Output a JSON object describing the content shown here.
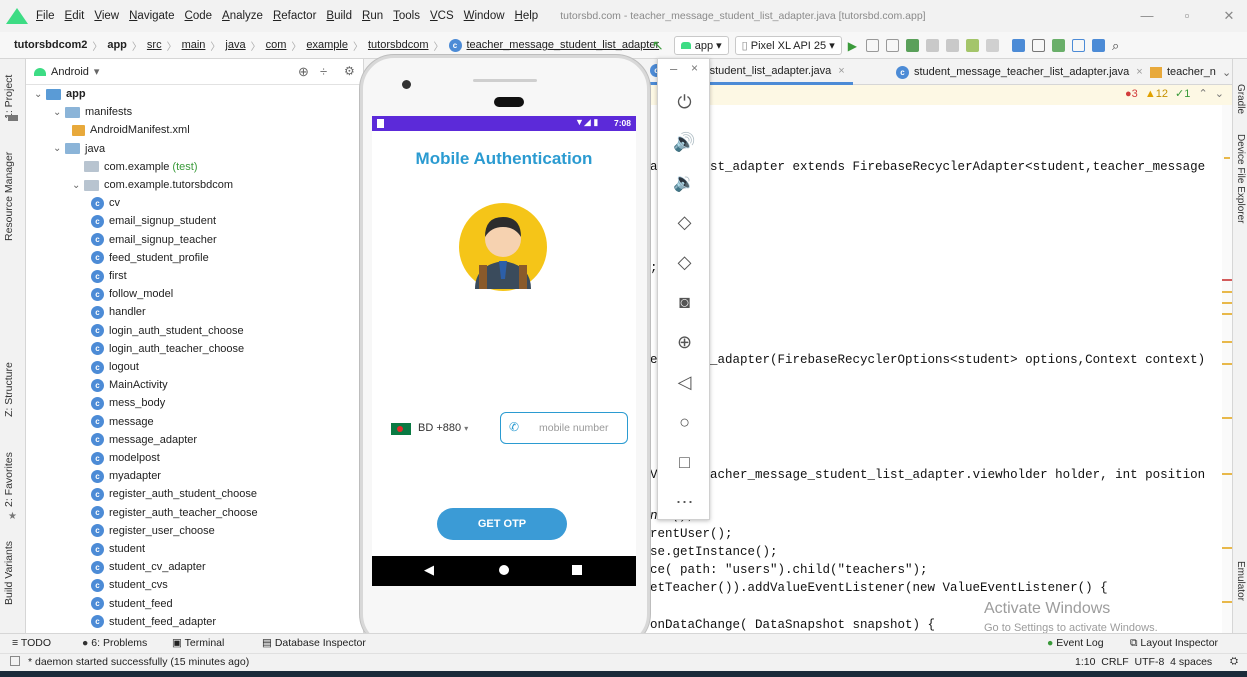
{
  "titlebar": {
    "menu": [
      "File",
      "Edit",
      "View",
      "Navigate",
      "Code",
      "Analyze",
      "Refactor",
      "Build",
      "Run",
      "Tools",
      "VCS",
      "Window",
      "Help"
    ],
    "window_title": "tutorsbd.com - teacher_message_student_list_adapter.java [tutorsbd.com.app]"
  },
  "breadcrumb": [
    "tutorsbdcom2",
    "app",
    "src",
    "main",
    "java",
    "com",
    "example",
    "tutorsbdcom",
    "teacher_message_student_list_adapter"
  ],
  "toolbar": {
    "run_config": "app",
    "device": "Pixel XL API 25"
  },
  "left_tabs": [
    "1: Project",
    "Resource Manager",
    "Z: Structure",
    "2: Favorites",
    "Build Variants"
  ],
  "right_tabs": [
    "Gradle",
    "Device File Explorer",
    "Emulator"
  ],
  "project": {
    "view_mode": "Android",
    "tree": [
      {
        "label": "app",
        "level": 0,
        "kind": "module"
      },
      {
        "label": "manifests",
        "level": 1,
        "kind": "folder"
      },
      {
        "label": "AndroidManifest.xml",
        "level": 2,
        "kind": "xml"
      },
      {
        "label": "java",
        "level": 1,
        "kind": "folder"
      },
      {
        "label": "com.example",
        "suffix": "(test)",
        "level": 2,
        "kind": "package"
      },
      {
        "label": "com.example.tutorsbdcom",
        "level": 2,
        "kind": "package"
      },
      {
        "label": "cv",
        "level": 3,
        "kind": "class"
      },
      {
        "label": "email_signup_student",
        "level": 3,
        "kind": "class"
      },
      {
        "label": "email_signup_teacher",
        "level": 3,
        "kind": "class"
      },
      {
        "label": "feed_student_profile",
        "level": 3,
        "kind": "class"
      },
      {
        "label": "first",
        "level": 3,
        "kind": "class"
      },
      {
        "label": "follow_model",
        "level": 3,
        "kind": "class"
      },
      {
        "label": "handler",
        "level": 3,
        "kind": "class"
      },
      {
        "label": "login_auth_student_choose",
        "level": 3,
        "kind": "class"
      },
      {
        "label": "login_auth_teacher_choose",
        "level": 3,
        "kind": "class"
      },
      {
        "label": "logout",
        "level": 3,
        "kind": "class"
      },
      {
        "label": "MainActivity",
        "level": 3,
        "kind": "class"
      },
      {
        "label": "mess_body",
        "level": 3,
        "kind": "class"
      },
      {
        "label": "message",
        "level": 3,
        "kind": "class"
      },
      {
        "label": "message_adapter",
        "level": 3,
        "kind": "class"
      },
      {
        "label": "modelpost",
        "level": 3,
        "kind": "class"
      },
      {
        "label": "myadapter",
        "level": 3,
        "kind": "class"
      },
      {
        "label": "register_auth_student_choose",
        "level": 3,
        "kind": "class"
      },
      {
        "label": "register_auth_teacher_choose",
        "level": 3,
        "kind": "class"
      },
      {
        "label": "register_user_choose",
        "level": 3,
        "kind": "class"
      },
      {
        "label": "student",
        "level": 3,
        "kind": "class"
      },
      {
        "label": "student_cv_adapter",
        "level": 3,
        "kind": "class"
      },
      {
        "label": "student_cvs",
        "level": 3,
        "kind": "class"
      },
      {
        "label": "student_feed",
        "level": 3,
        "kind": "class"
      },
      {
        "label": "student_feed_adapter",
        "level": 3,
        "kind": "class"
      }
    ]
  },
  "editor": {
    "tabs": [
      "essage_student_list_adapter.java",
      "student_message_teacher_list_adapter.java",
      "teacher_n"
    ],
    "inspections": {
      "errors": "3",
      "warnings": "12",
      "typos": "1"
    },
    "code": [
      "nt_list_adapter extends FirebaseRecyclerAdapter<student,teacher_message",
      "_list_adapter(FirebaseRecyclerOptions<student> options,Context context)",
      "r( teacher_message_student_list_adapter.viewholder holder, int position",
      "nce();",
      "rentUser();",
      "se.getInstance();",
      "ce( path: \"users\").child(\"teachers\");",
      "etTeacher()).addValueEventListener(new ValueEventListener() {",
      "onDataChange( DataSnapshot snapshot) {"
    ]
  },
  "watermark": {
    "title": "Activate Windows",
    "subtitle": "Go to Settings to activate Windows."
  },
  "bottom_tabs": [
    "TODO",
    "6: Problems",
    "Terminal",
    "Database Inspector"
  ],
  "bottom_right_tabs": [
    "Event Log",
    "Layout Inspector"
  ],
  "status": {
    "message": "* daemon started successfully (15 minutes ago)",
    "position": "1:10",
    "line_sep": "CRLF",
    "encoding": "UTF-8",
    "indent": "4 spaces"
  },
  "phone": {
    "time": "7:08",
    "title": "Mobile Authentication",
    "country_code": "BD +880",
    "phone_placeholder": "mobile number",
    "otp_button": "GET OTP"
  },
  "emulator_controls": [
    "power",
    "volume-up",
    "volume-down",
    "rotate-left",
    "rotate-right",
    "screenshot",
    "zoom",
    "back",
    "home",
    "overview",
    "more"
  ],
  "colors": {
    "accent": "#2b9bd1",
    "status_bar": "#5c2ad9",
    "button": "#3b9bd6",
    "ide_accent": "#4c8bd6"
  }
}
